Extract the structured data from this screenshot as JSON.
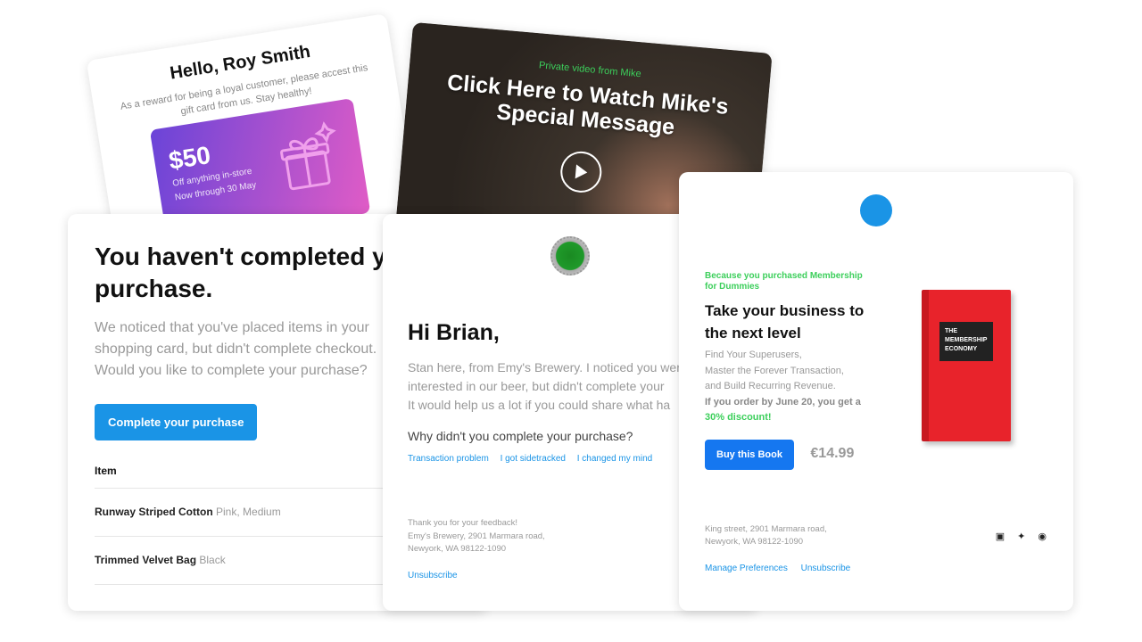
{
  "gift_card": {
    "title": "Hello, Roy Smith",
    "text": "As a reward for being a loyal customer, please accest this gift card from us. Stay healthy!",
    "amount": "$50",
    "line1": "Off anything in-store",
    "line2": "Now through 30 May",
    "gradient": [
      "#6a44d8",
      "#e05cc6"
    ]
  },
  "video": {
    "eyebrow": "Private video from Mike",
    "title": "Click Here to Watch Mike's Special Message",
    "icon": "play-icon"
  },
  "cart": {
    "title": "You haven't completed your purchase.",
    "text": "We noticed that you've placed items in your shopping card, but didn't complete checkout. Would you like to complete your purchase?",
    "button": "Complete your purchase",
    "item_header": "Item",
    "items": [
      {
        "name": "Runway Striped Cotton",
        "variant": "Pink, Medium"
      },
      {
        "name": "Trimmed Velvet Bag",
        "variant": "Black"
      }
    ]
  },
  "brewery": {
    "greeting": "Hi Brian,",
    "lines": [
      "Stan here, from Emy's Brewery. I noticed you were",
      "interested in our beer, but didn't complete your",
      "It would help us a lot if you could share what ha"
    ],
    "question": "Why didn't you complete your purchase?",
    "options": [
      "Transaction problem",
      "I got sidetracked",
      "I changed my mind"
    ],
    "footer": [
      "Thank you for your feedback!",
      "Emy's Brewery, 2901 Marmara road,",
      "Newyork, WA 98122-1090"
    ],
    "unsubscribe": "Unsubscribe"
  },
  "book": {
    "tag": "Because you purchased Membership for Dummies",
    "title": "Take your business to the next level",
    "desc": [
      "Find Your Superusers,",
      "Master the Forever Transaction,",
      "and Build Recurring Revenue."
    ],
    "offer": "If you order by June 20, you get a",
    "discount": "30% discount!",
    "button": "Buy this Book",
    "price": "€14.99",
    "cover_title": "THE MEMBERSHIP ECONOMY",
    "footer": [
      "King street, 2901 Marmara road,",
      "Newyork, WA 98122-1090"
    ],
    "links": [
      "Manage Preferences",
      "Unsubscribe"
    ],
    "social": [
      "facebook-icon",
      "twitter-icon",
      "instagram-icon"
    ],
    "accent": "#1577f0",
    "green": "#3ccf5b"
  }
}
